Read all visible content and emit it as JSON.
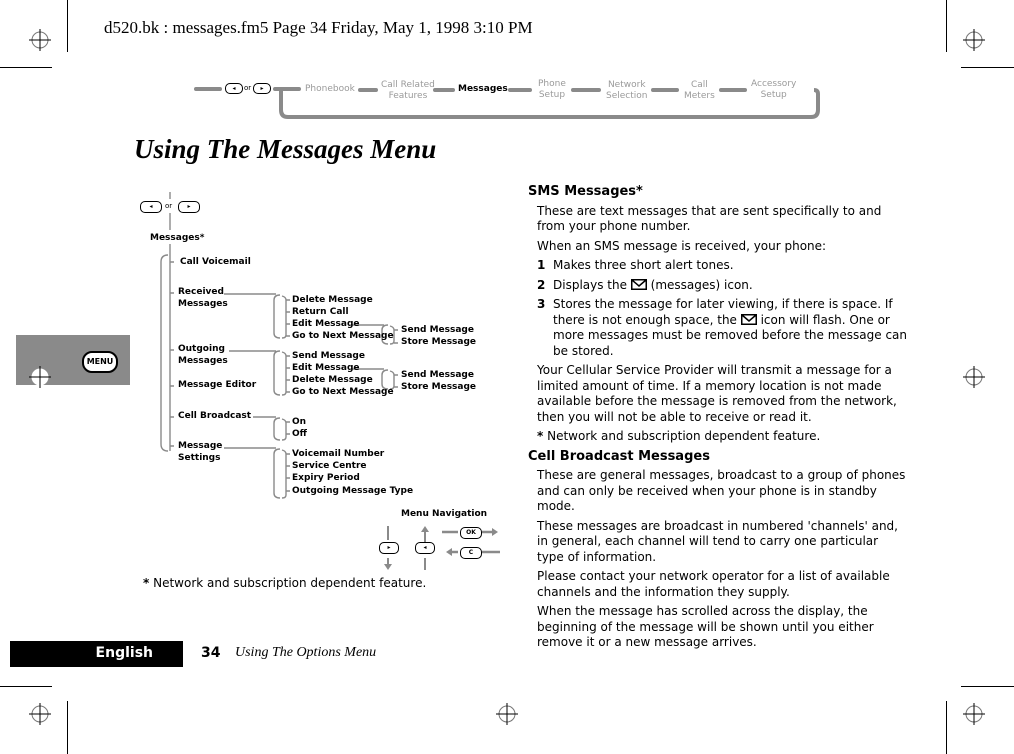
{
  "header": {
    "print_info": "d520.bk : messages.fm5  Page 34  Friday, May 1, 1998  3:10 PM"
  },
  "nav_strip": {
    "keys_label": "or",
    "key_left": "◂",
    "key_right": "▸",
    "items": [
      {
        "line1": "Phonebook",
        "line2": "",
        "active": false
      },
      {
        "line1": "Call Related",
        "line2": "Features",
        "active": false
      },
      {
        "line1": "Messages",
        "line2": "",
        "active": true
      },
      {
        "line1": "Phone",
        "line2": "Setup",
        "active": false
      },
      {
        "line1": "Network",
        "line2": "Selection",
        "active": false
      },
      {
        "line1": "Call",
        "line2": "Meters",
        "active": false
      },
      {
        "line1": "Accessory",
        "line2": "Setup",
        "active": false
      }
    ]
  },
  "page_title": "Using The Messages Menu",
  "side_tab": {
    "menu_key": "MENU"
  },
  "tree": {
    "keys_label": "or",
    "root": "Messages*",
    "l1": {
      "call_voicemail": "Call Voicemail",
      "received_1": "Received",
      "received_2": "Messages",
      "outgoing_1": "Outgoing",
      "outgoing_2": "Messages",
      "editor": "Message Editor",
      "cell_broadcast": "Cell Broadcast",
      "settings_1": "Message",
      "settings_2": "Settings"
    },
    "received_children": [
      "Delete Message",
      "Return Call",
      "Edit Message",
      "Go to Next Message"
    ],
    "received_edit_children": [
      "Send Message",
      "Store Message"
    ],
    "outgoing_children": [
      "Send Message",
      "Edit Message",
      "Delete Message",
      "Go to Next Message"
    ],
    "outgoing_edit_children": [
      "Send Message",
      "Store Message"
    ],
    "broadcast_children": [
      "On",
      "Off"
    ],
    "settings_children": [
      "Voicemail Number",
      "Service Centre",
      "Expiry Period",
      "Outgoing Message Type"
    ],
    "footnote": "* Network and subscription dependent feature."
  },
  "menu_navigation": {
    "title": "Menu Navigation",
    "ok_key": "OK",
    "c_key": "C",
    "down_key": "▸",
    "up_key": "◂"
  },
  "content": {
    "sms_heading": "SMS Messages*",
    "sms_p1": "These are text messages that are sent specifically to and from your phone number.",
    "sms_p2": "When an SMS message is received, your phone:",
    "steps": [
      {
        "num": "1",
        "before": "Makes three short alert tones.",
        "after": ""
      },
      {
        "num": "2",
        "before": "Displays the",
        "after": "(messages) icon."
      },
      {
        "num": "3",
        "before": "Stores the message for later viewing, if there is space. If there is not enough space, the",
        "after": "icon will flash. One or more messages must be removed before the message can be stored."
      }
    ],
    "sms_p3": "Your Cellular Service Provider will transmit a message for a limited amount of time. If a memory location is not made available before the message is removed from the network, then you will not be able to receive or read it.",
    "sms_note_star": "*",
    "sms_note": " Network and subscription dependent feature.",
    "cb_heading": "Cell Broadcast Messages",
    "cb_p1": "These are general messages, broadcast to a group of phones and can only be received when your phone is in standby mode.",
    "cb_p2": "These messages are broadcast in numbered 'channels' and, in general, each channel will tend to carry one particular type of information.",
    "cb_p3": "Please contact your network operator for a list of available channels and the information they supply.",
    "cb_p4": "When the message has scrolled across the display, the beginning of the message will be shown until you either remove it or a new message arrives."
  },
  "footer": {
    "language": "English",
    "page_number": "34",
    "section": "Using The Options Menu"
  }
}
